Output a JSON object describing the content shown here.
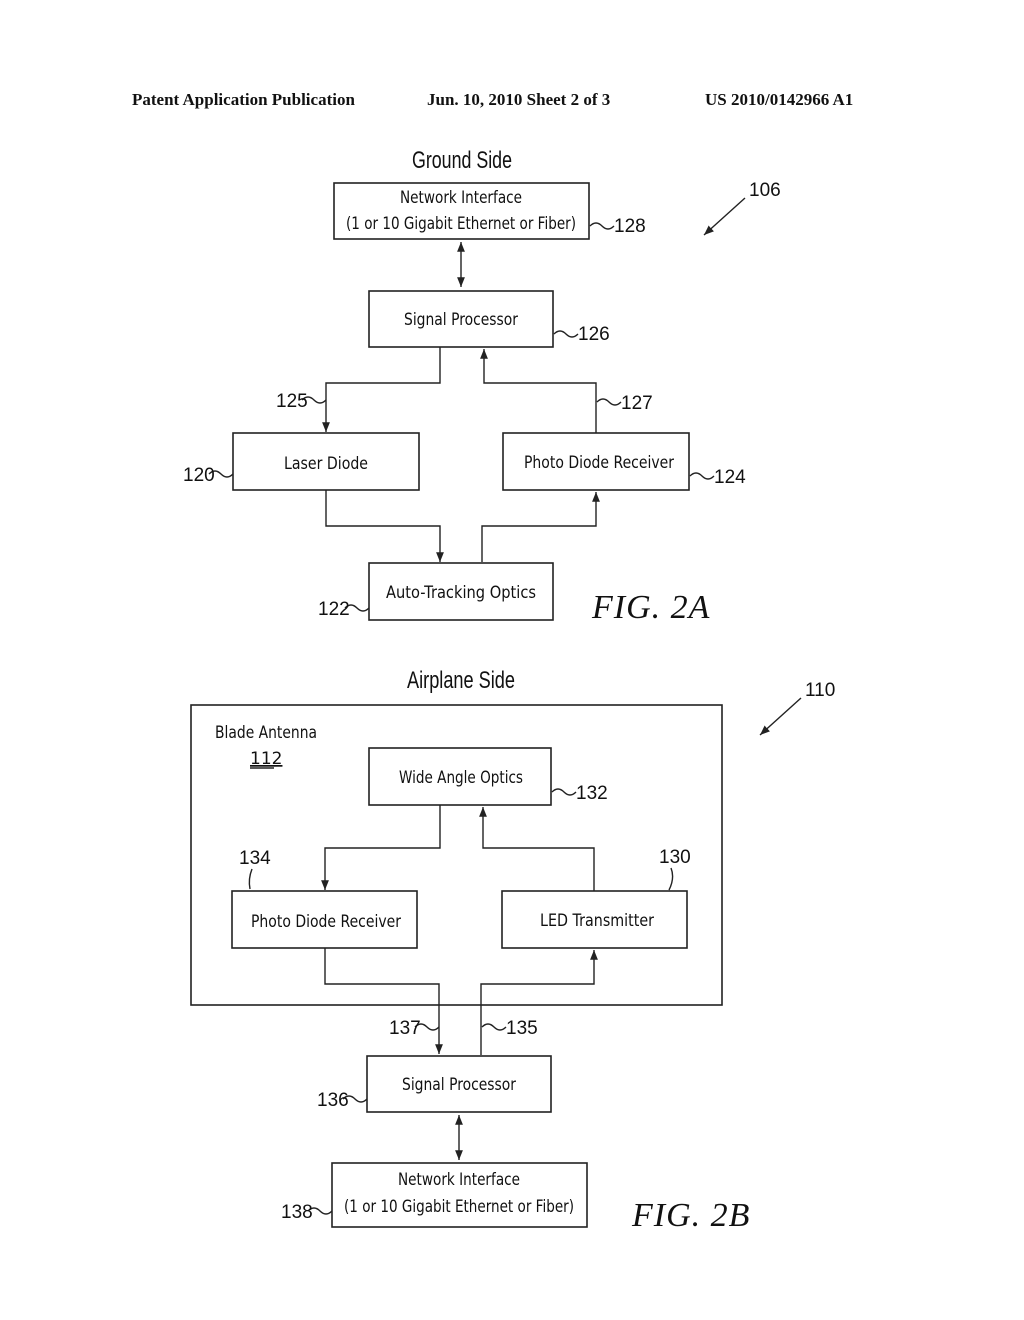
{
  "header": {
    "publication": "Patent Application Publication",
    "date_sheet": "Jun. 10, 2010  Sheet 2 of 3",
    "number": "US 2010/0142966 A1"
  },
  "fig2a": {
    "title": "Ground Side",
    "figure_label": "FIG.  2A",
    "ref_assembly": "106",
    "network_interface": {
      "line1": "Network Interface",
      "line2": "(1 or 10 Gigabit Ethernet or Fiber)",
      "ref": "128"
    },
    "signal_processor": {
      "label": "Signal Processor",
      "ref": "126"
    },
    "laser_diode": {
      "label": "Laser Diode",
      "ref": "120"
    },
    "photo_diode_receiver": {
      "label": "Photo Diode Receiver",
      "ref": "124"
    },
    "auto_tracking_optics": {
      "label": "Auto-Tracking Optics",
      "ref": "122"
    },
    "path_out_ref": "125",
    "path_in_ref": "127"
  },
  "fig2b": {
    "title": "Airplane Side",
    "figure_label": "FIG.  2B",
    "ref_assembly": "110",
    "blade_antenna": {
      "label": "Blade Antenna",
      "ref": "112"
    },
    "wide_angle_optics": {
      "label": "Wide Angle Optics",
      "ref": "132"
    },
    "photo_diode_receiver": {
      "label": "Photo Diode Receiver",
      "ref": "134"
    },
    "led_transmitter": {
      "label": "LED Transmitter",
      "ref": "130"
    },
    "signal_processor": {
      "label": "Signal Processor",
      "ref": "136"
    },
    "network_interface": {
      "line1": "Network Interface",
      "line2": "(1 or 10 Gigabit Ethernet or Fiber)",
      "ref": "138"
    },
    "path_in_ref": "137",
    "path_out_ref": "135"
  }
}
